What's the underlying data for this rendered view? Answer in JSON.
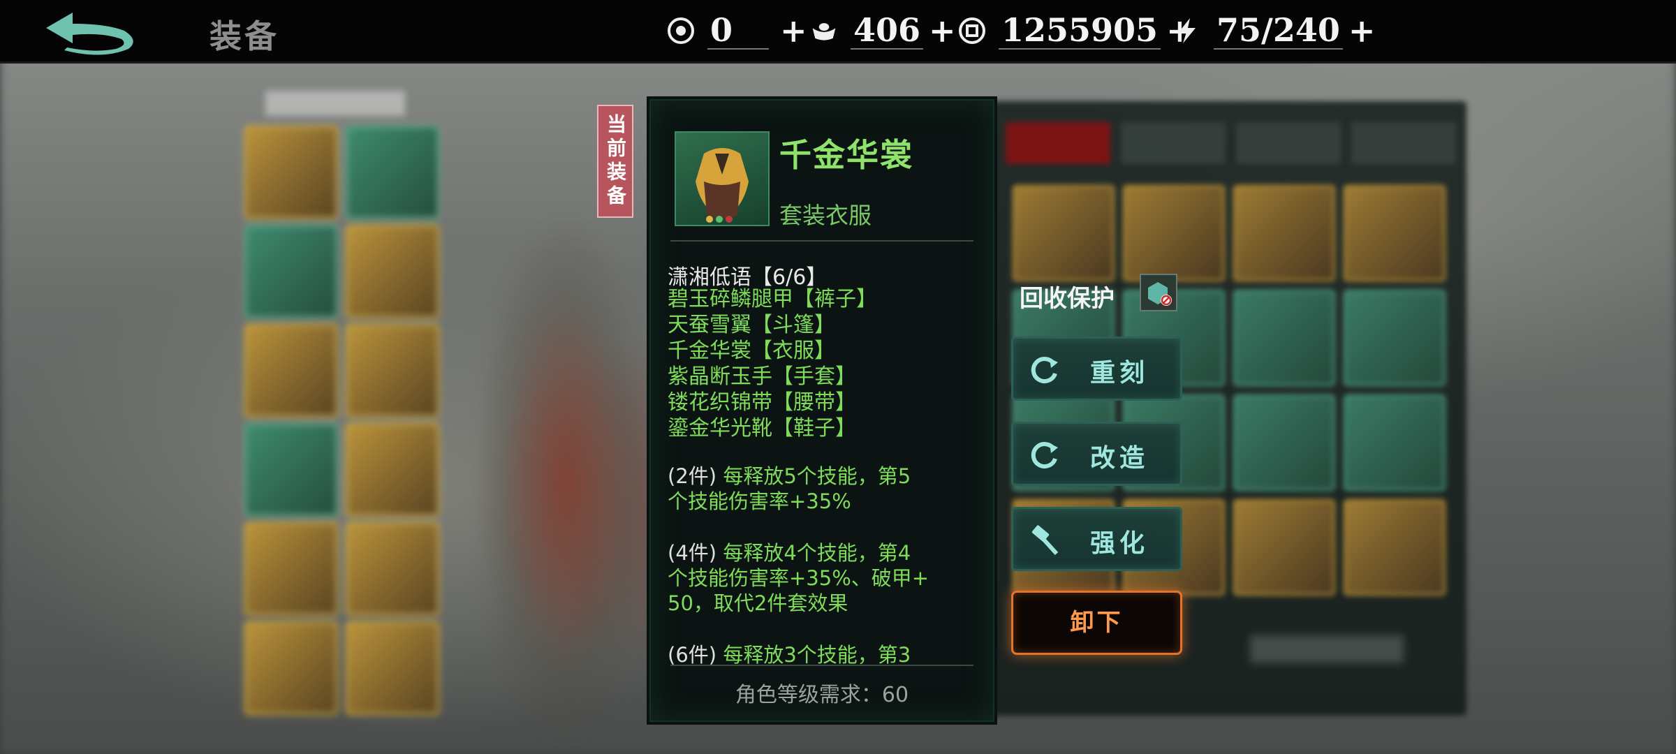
{
  "header": {
    "title": "装备",
    "currencies": [
      {
        "icon": "coupon-icon",
        "value": "0",
        "plus": "+"
      },
      {
        "icon": "silver-ingot-icon",
        "value": "406",
        "plus": "+"
      },
      {
        "icon": "coin-icon",
        "value": "1255905",
        "plus": "+"
      },
      {
        "icon": "lightning-icon",
        "value": "75/240",
        "plus": "+"
      }
    ]
  },
  "current_tag": "当前装备",
  "item": {
    "name": "千金华裳",
    "type": "套装衣服",
    "set_title": "潇湘低语【6/6】",
    "set_pieces": [
      "碧玉碎鳞腿甲【裤子】",
      "天蚕雪翼【斗篷】",
      "千金华裳【衣服】",
      "紫晶断玉手【手套】",
      "镂花织锦带【腰带】",
      "鎏金华光靴【鞋子】"
    ],
    "bonuses": [
      {
        "key": "(2件)",
        "line1": "每释放5个技能，第5",
        "line2": "个技能伤害率+35%"
      },
      {
        "key": "(4件)",
        "line1": "每释放4个技能，第4",
        "line2": "个技能伤害率+35%、破甲+",
        "line3": "50，取代2件套效果"
      },
      {
        "key": "(6件)",
        "line1": "每释放3个技能，第3"
      }
    ],
    "requirement": "角色等级需求：60"
  },
  "actions": {
    "recycle_label": "回收保护",
    "recast": "重刻",
    "modify": "改造",
    "enhance": "强化",
    "unequip": "卸下"
  },
  "colors": {
    "set_green": "#7fdc5a",
    "name_green": "#8fe36b",
    "button_teal": "#9fe7de",
    "unequip_orange": "#e2752a",
    "tag_red": "#b8555c"
  }
}
